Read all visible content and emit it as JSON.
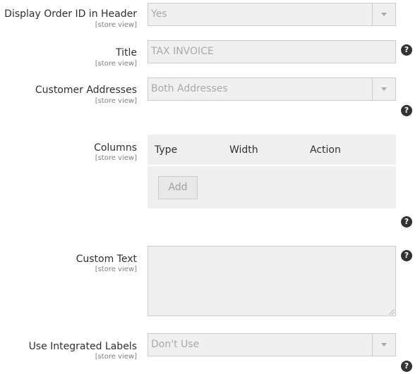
{
  "scope_label": "[store view]",
  "fields": {
    "display_order_id": {
      "label": "Display Order ID in Header",
      "value": "Yes"
    },
    "title": {
      "label": "Title",
      "placeholder": "TAX INVOICE"
    },
    "customer_addresses": {
      "label": "Customer Addresses",
      "value": "Both Addresses"
    },
    "columns": {
      "label": "Columns",
      "headers": [
        "Type",
        "Width",
        "Action"
      ],
      "add_label": "Add"
    },
    "custom_text": {
      "label": "Custom Text"
    },
    "integrated_labels": {
      "label": "Use Integrated Labels",
      "value": "Don't Use"
    }
  },
  "help_glyph": "?",
  "icons": {
    "help": "question-circle-icon",
    "dropdown": "chevron-down-icon"
  },
  "colors": {
    "help_icon_bg": "#333333",
    "field_bg": "#f0f0f0",
    "field_border": "#cccccc",
    "disabled_text": "#a9a9a9"
  }
}
